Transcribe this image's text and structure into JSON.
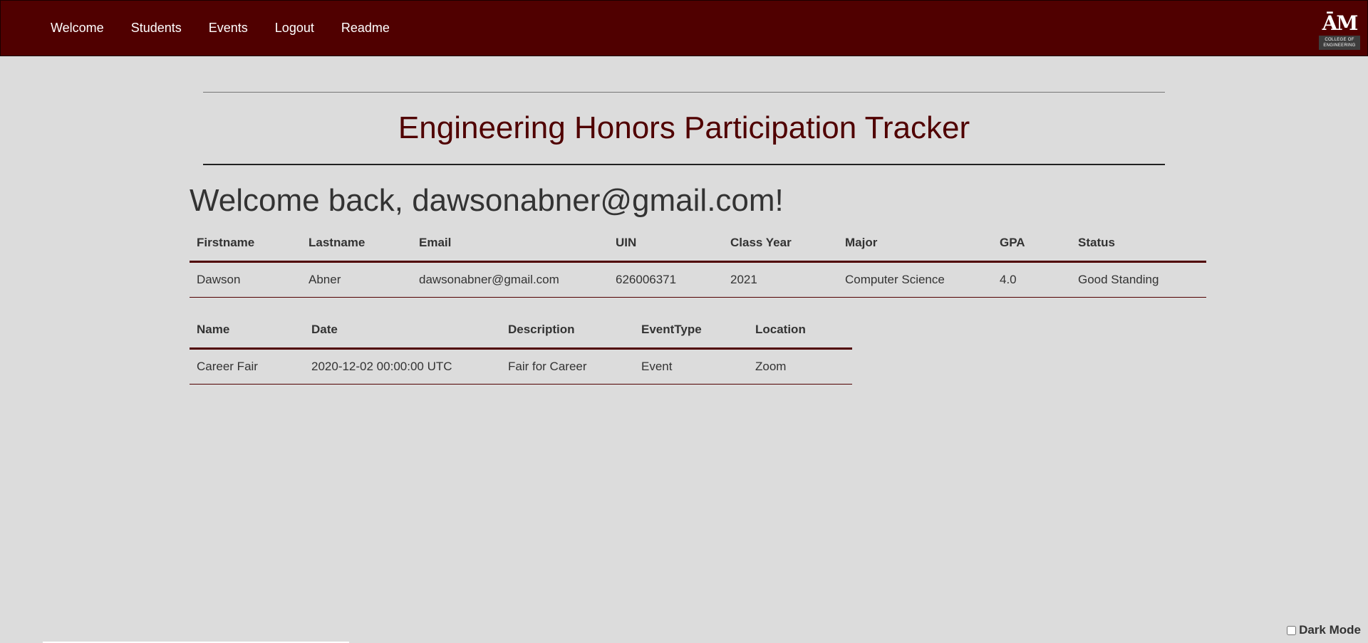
{
  "nav": {
    "items": [
      "Welcome",
      "Students",
      "Events",
      "Logout",
      "Readme"
    ]
  },
  "logo": {
    "mark": "ĀM",
    "caption": "COLLEGE OF ENGINEERING"
  },
  "page_title": "Engineering Honors Participation Tracker",
  "welcome": "Welcome back, dawsonabner@gmail.com!",
  "student_table": {
    "headers": [
      "Firstname",
      "Lastname",
      "Email",
      "UIN",
      "Class Year",
      "Major",
      "GPA",
      "Status"
    ],
    "rows": [
      [
        "Dawson",
        "Abner",
        "dawsonabner@gmail.com",
        "626006371",
        "2021",
        "Computer Science",
        "4.0",
        "Good Standing"
      ]
    ]
  },
  "event_table": {
    "headers": [
      "Name",
      "Date",
      "Description",
      "EventType",
      "Location"
    ],
    "rows": [
      [
        "Career Fair",
        "2020-12-02 00:00:00 UTC",
        "Fair for Career",
        "Event",
        "Zoom"
      ]
    ]
  },
  "dark_mode": {
    "label": "Dark Mode",
    "checked": false
  },
  "colors": {
    "brand": "#500000",
    "background": "#dcdcdc",
    "text": "#333333"
  }
}
